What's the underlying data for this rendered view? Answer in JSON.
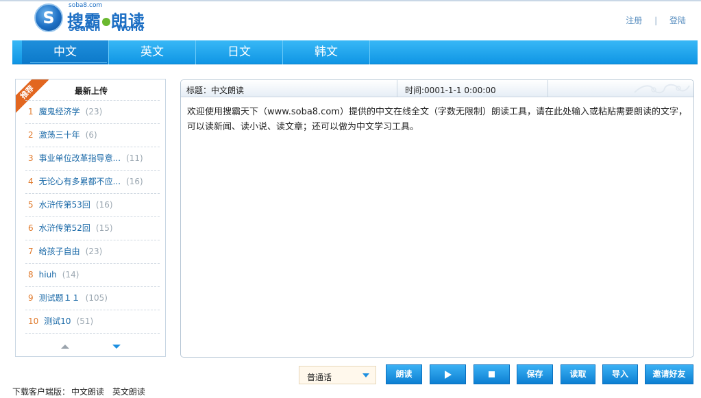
{
  "logo": {
    "domain": "soba8.com",
    "name_cn_1": "搜霸",
    "name_cn_2": "朗读",
    "name_en_1": "Search",
    "name_en_2": "World",
    "mark": "S"
  },
  "auth": {
    "register": "注册",
    "separator": "|",
    "login": "登陆"
  },
  "nav": {
    "items": [
      {
        "label": "中文",
        "active": true
      },
      {
        "label": "英文",
        "active": false
      },
      {
        "label": "日文",
        "active": false
      },
      {
        "label": "韩文",
        "active": false
      }
    ]
  },
  "sidebar": {
    "ribbon": "推荐",
    "title": "最新上传",
    "items": [
      {
        "num": "1",
        "title": "魔鬼经济学",
        "count": "(23)"
      },
      {
        "num": "2",
        "title": "激荡三十年",
        "count": "(6)"
      },
      {
        "num": "3",
        "title": "事业单位改革指导意...",
        "count": "(11)"
      },
      {
        "num": "4",
        "title": "无论心有多累都不应...",
        "count": "(16)"
      },
      {
        "num": "5",
        "title": "水浒传第53回",
        "count": "(16)"
      },
      {
        "num": "6",
        "title": "水浒传第52回",
        "count": "(15)"
      },
      {
        "num": "7",
        "title": "给孩子自由",
        "count": "(23)"
      },
      {
        "num": "8",
        "title": "hiuh",
        "count": "(14)"
      },
      {
        "num": "9",
        "title": "测试题１１",
        "count": "(105)"
      },
      {
        "num": "10",
        "title": "测试10",
        "count": "(51)"
      }
    ]
  },
  "editor": {
    "title_label": "标题：",
    "title_value": "中文朗读",
    "time_label": "时间:",
    "time_value": "0001-1-1 0:00:00",
    "text": "欢迎使用搜霸天下（www.soba8.com）提供的中文在线全文（字数无限制）朗读工具，请在此处输入或粘贴需要朗读的文字，可以读新闻、读小说、读文章；还可以做为中文学习工具。"
  },
  "toolbar": {
    "voice_selected": "普通话",
    "read": "朗读",
    "save": "保存",
    "load": "读取",
    "import": "导入",
    "invite": "邀请好友"
  },
  "footer": {
    "label": "下载客户端版：",
    "link_cn": "中文朗读",
    "link_en": "英文朗读"
  },
  "colors": {
    "nav_blue": "#0f95e4",
    "button_blue": "#0c7fd2",
    "number_orange": "#e07a2c",
    "ribbon_orange": "#e2661f",
    "link_blue": "#1b6aa8"
  }
}
